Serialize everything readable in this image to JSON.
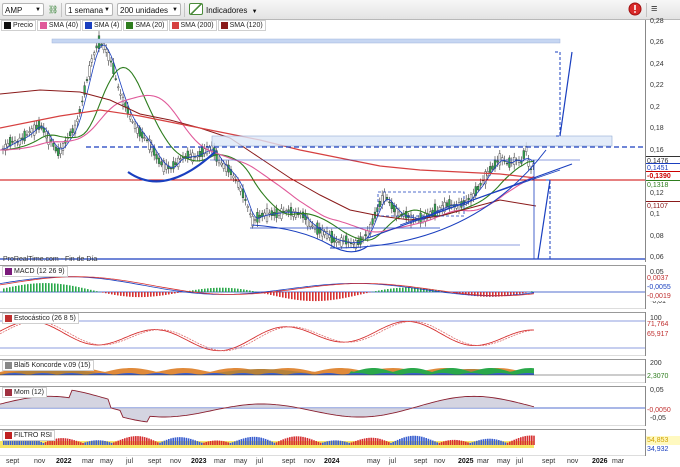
{
  "toolbar": {
    "ticker": "AMP",
    "timeframe": "1 semana",
    "units": "200 unidades",
    "indicators_label": "Indicadores"
  },
  "price_legend": [
    {
      "label": "Precio",
      "color": "#111111"
    },
    {
      "label": "SMA (40)",
      "color": "#e05a9a"
    },
    {
      "label": "SMA (4)",
      "color": "#1a3fbf"
    },
    {
      "label": "SMA (20)",
      "color": "#2e7d1e"
    },
    {
      "label": "SMA (200)",
      "color": "#d64040"
    },
    {
      "label": "SMA (120)",
      "color": "#8a1a1a"
    }
  ],
  "price_axis": {
    "ticks": [
      "0,28",
      "0,26",
      "0,24",
      "0,22",
      "0,2",
      "0,18",
      "0,16",
      "0,14",
      "0,12",
      "0,1",
      "0,08",
      "0,06"
    ],
    "tags": [
      {
        "text": "0,1476",
        "color": "#333333"
      },
      {
        "text": "0,1451",
        "color": "#1a3fbf"
      },
      {
        "text": "-0,1390",
        "color": "#cc0000"
      },
      {
        "text": "0,1318",
        "color": "#2e7d1e"
      },
      {
        "text": "0,1107",
        "color": "#8a1a1a"
      }
    ]
  },
  "footer_text": "ProRealTime.com - Fin de Día",
  "panels": [
    {
      "label": "MACD (12 26 9)",
      "ticks": [
        "0,05",
        "-0,01"
      ],
      "values": [
        "0,0037",
        "-0,0055",
        "-0,0019"
      ]
    },
    {
      "label": "Estocástico (26 8 5)",
      "ticks": [
        "100",
        "50"
      ],
      "values": [
        "71,764",
        "65,917"
      ]
    },
    {
      "label": "Blai5 Koncorde v.09 (15)",
      "ticks": [
        "200"
      ],
      "values": [
        "2,3070"
      ]
    },
    {
      "label": "Mom (12)",
      "ticks": [
        "0,05",
        "-0,05"
      ],
      "values": [
        "-0,0050"
      ]
    },
    {
      "label": "FILTRO RSI",
      "ticks": [],
      "values": [
        "54,853",
        "34,932"
      ]
    }
  ],
  "x_axis": [
    {
      "text": "sept",
      "year": false
    },
    {
      "text": "nov",
      "year": false
    },
    {
      "text": "2022",
      "year": true
    },
    {
      "text": "mar",
      "year": false
    },
    {
      "text": "may",
      "year": false
    },
    {
      "text": "jul",
      "year": false
    },
    {
      "text": "sept",
      "year": false
    },
    {
      "text": "nov",
      "year": false
    },
    {
      "text": "2023",
      "year": true
    },
    {
      "text": "mar",
      "year": false
    },
    {
      "text": "may",
      "year": false
    },
    {
      "text": "jul",
      "year": false
    },
    {
      "text": "sept",
      "year": false
    },
    {
      "text": "nov",
      "year": false
    },
    {
      "text": "2024",
      "year": true
    },
    {
      "text": "may",
      "year": false
    },
    {
      "text": "jul",
      "year": false
    },
    {
      "text": "sept",
      "year": false
    },
    {
      "text": "nov",
      "year": false
    },
    {
      "text": "2025",
      "year": true
    },
    {
      "text": "mar",
      "year": false
    },
    {
      "text": "may",
      "year": false
    },
    {
      "text": "jul",
      "year": false
    },
    {
      "text": "sept",
      "year": false
    },
    {
      "text": "nov",
      "year": false
    },
    {
      "text": "2026",
      "year": true
    },
    {
      "text": "mar",
      "year": false
    }
  ]
}
